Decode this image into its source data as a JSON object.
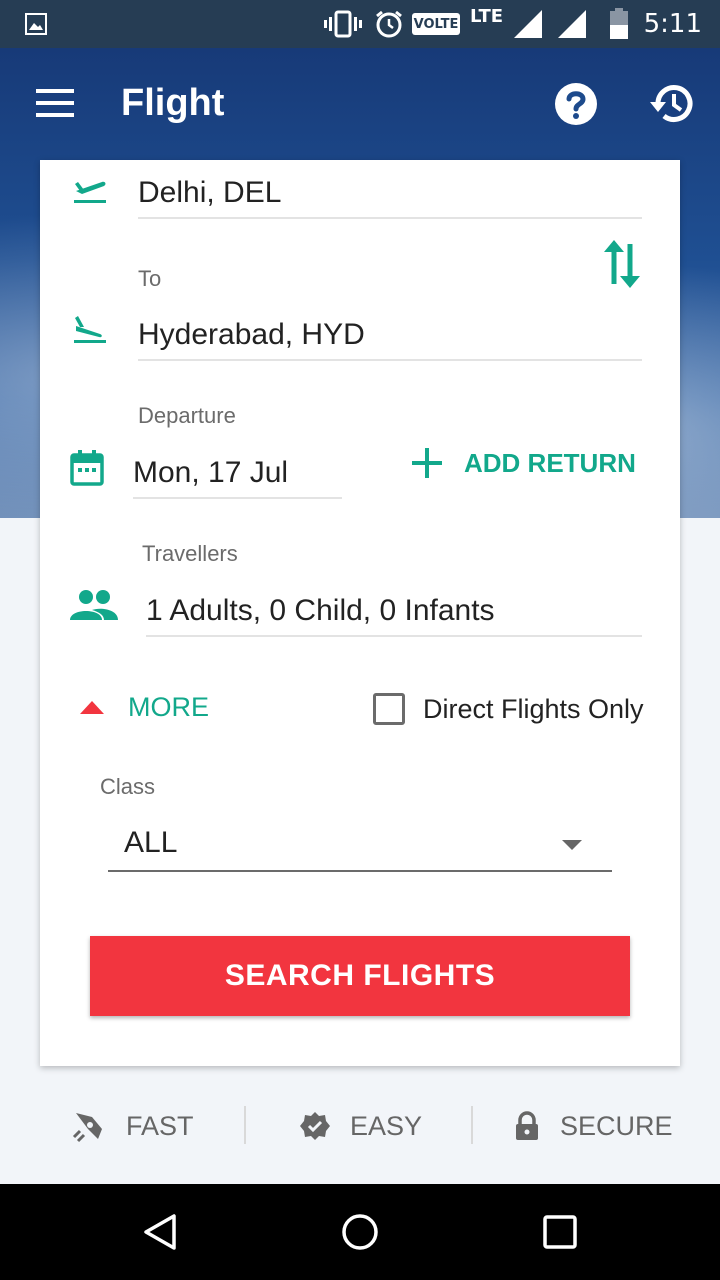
{
  "status_bar": {
    "time": "5:11",
    "volte_label": "VOLTE",
    "lte_label": "LTE"
  },
  "app_bar": {
    "title": "Flight"
  },
  "form": {
    "from": {
      "value": "Delhi, DEL"
    },
    "to": {
      "label": "To",
      "value": "Hyderabad, HYD"
    },
    "departure": {
      "label": "Departure",
      "value": "Mon, 17 Jul"
    },
    "add_return_label": "ADD RETURN",
    "travellers": {
      "label": "Travellers",
      "value": "1 Adults, 0 Child, 0 Infants"
    },
    "more_label": "MORE",
    "direct_flights_label": "Direct Flights Only",
    "class": {
      "label": "Class",
      "value": "ALL"
    },
    "search_button_label": "SEARCH FLIGHTS"
  },
  "features": [
    {
      "label": "FAST",
      "icon": "rocket-icon"
    },
    {
      "label": "EASY",
      "icon": "verified-badge-icon"
    },
    {
      "label": "SECURE",
      "icon": "lock-icon"
    }
  ],
  "colors": {
    "accent_green": "#12a88b",
    "button_red": "#f2353f",
    "status_bar": "#263d54"
  }
}
